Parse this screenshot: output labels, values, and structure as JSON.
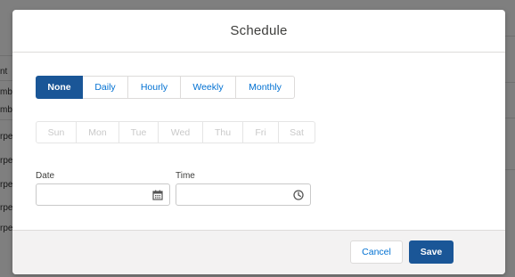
{
  "background": {
    "left_fragments": [
      "nt",
      "mb",
      "mb",
      "rpe",
      "rpe",
      "rpe",
      "rpe",
      "rpe"
    ]
  },
  "modal": {
    "title": "Schedule",
    "frequency_options": [
      "None",
      "Daily",
      "Hourly",
      "Weekly",
      "Monthly"
    ],
    "selected_frequency": "None",
    "days": [
      "Sun",
      "Mon",
      "Tue",
      "Wed",
      "Thu",
      "Fri",
      "Sat"
    ],
    "date": {
      "label": "Date",
      "value": "",
      "icon": "calendar-icon"
    },
    "time": {
      "label": "Time",
      "value": "",
      "icon": "clock-icon"
    },
    "footer": {
      "cancel_label": "Cancel",
      "save_label": "Save"
    }
  },
  "colors": {
    "brand": "#1a5697",
    "link": "#0070d2",
    "disabled_text": "#c9c9c9",
    "footer_bg": "#f3f2f2"
  }
}
